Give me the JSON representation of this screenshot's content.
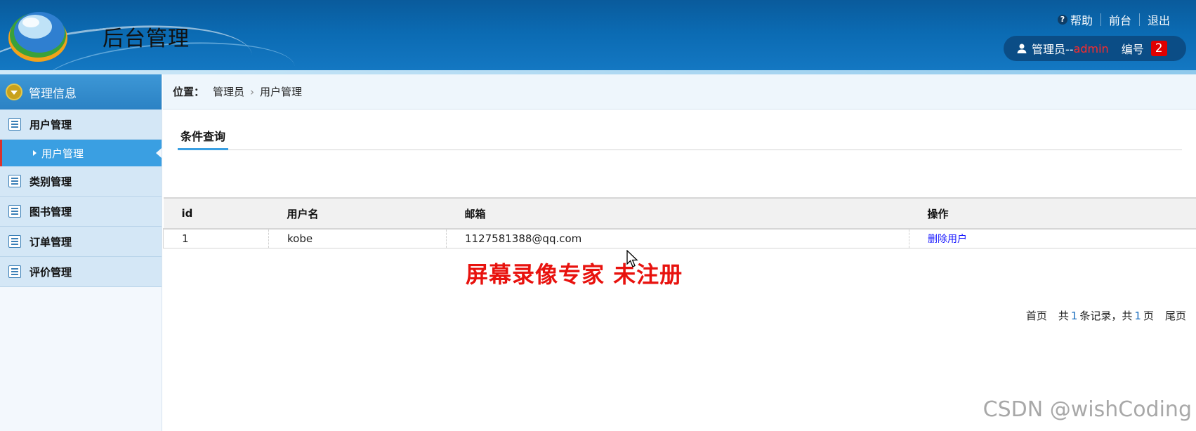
{
  "header": {
    "title": "后台管理",
    "links": {
      "help": "帮助",
      "front": "前台",
      "logout": "退出"
    },
    "user": {
      "prefix": "管理员--",
      "name": "admin",
      "number_label": "编号",
      "number": "2"
    }
  },
  "sidebar": {
    "section_title": "管理信息",
    "groups": [
      {
        "label": "用户管理",
        "children": [
          {
            "label": "用户管理",
            "active": true
          }
        ]
      },
      {
        "label": "类别管理"
      },
      {
        "label": "图书管理"
      },
      {
        "label": "订单管理"
      },
      {
        "label": "评价管理"
      }
    ]
  },
  "breadcrumb": {
    "label": "位置：",
    "items": [
      "管理员",
      "用户管理"
    ]
  },
  "tabs": [
    {
      "label": "条件查询",
      "active": true
    }
  ],
  "table": {
    "columns": [
      "id",
      "用户名",
      "邮箱",
      "操作"
    ],
    "rows": [
      {
        "id": "1",
        "username": "kobe",
        "email": "1127581388@qq.com",
        "action": "删除用户"
      }
    ]
  },
  "pager": {
    "first": "首页",
    "total_prefix": "共",
    "total_records": "1",
    "records_suffix": "条记录，共",
    "total_pages": "1",
    "pages_suffix": "页",
    "last": "尾页"
  },
  "overlay": {
    "watermark": "屏幕录像专家  未注册",
    "credit": "CSDN @wishCoding"
  }
}
